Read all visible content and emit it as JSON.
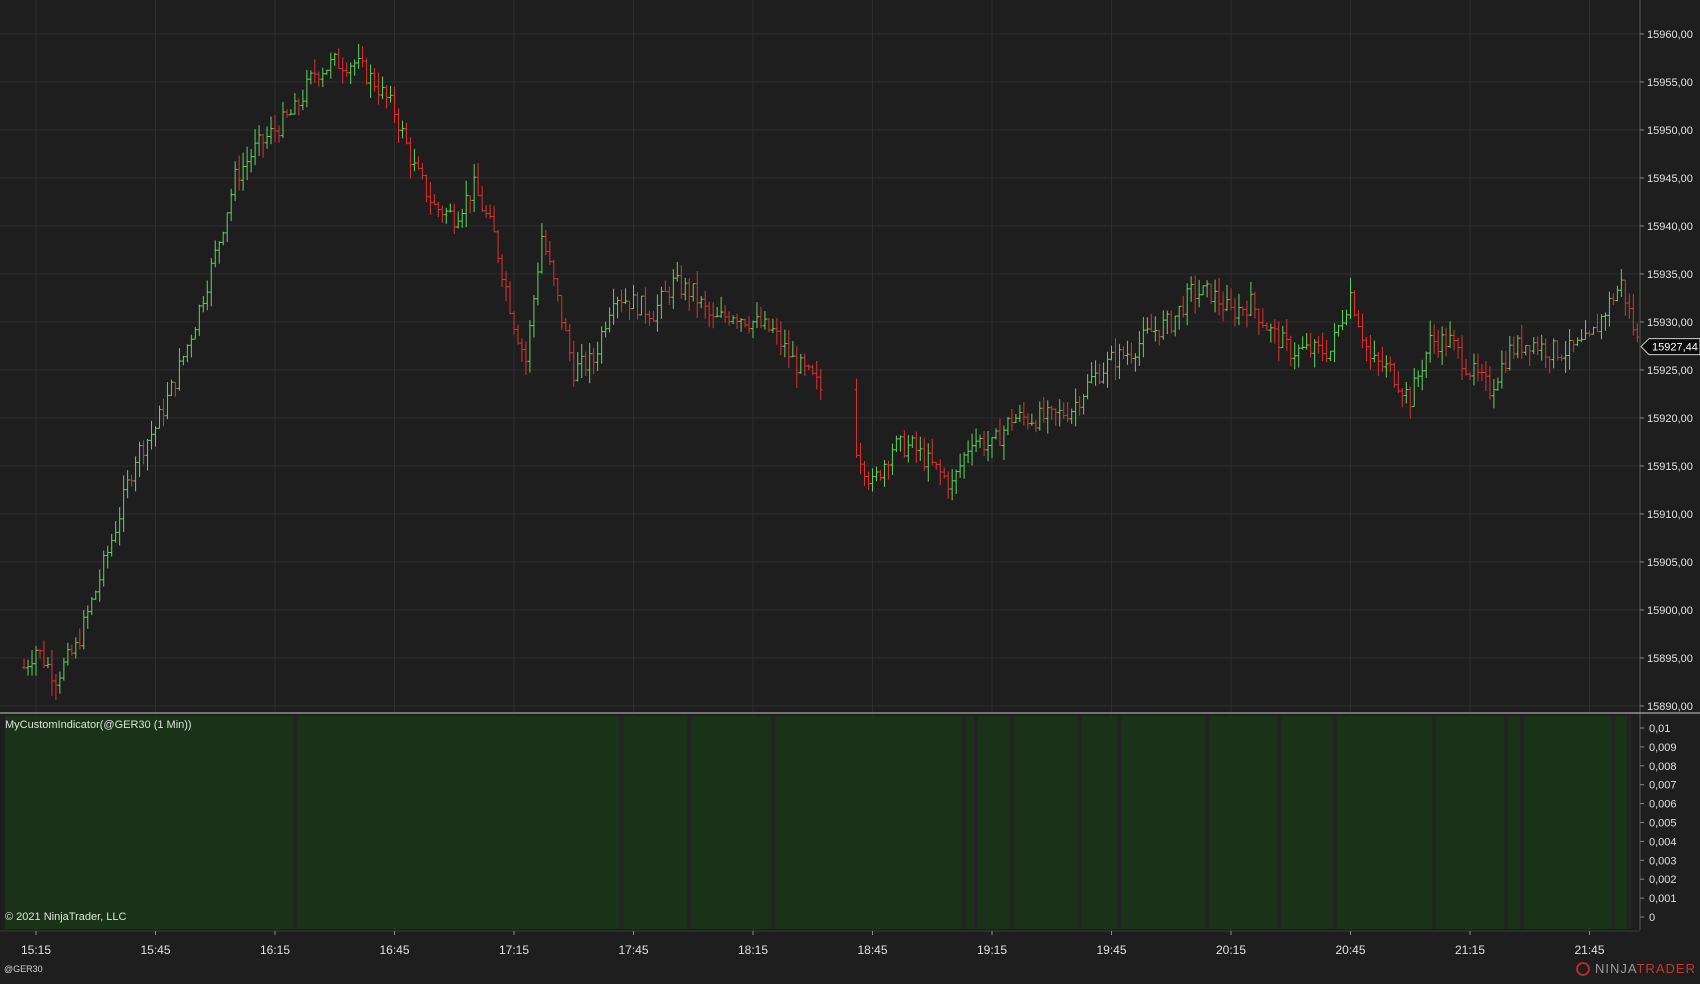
{
  "indicator_label": "MyCustomIndicator(@GER30 (1 Min))",
  "copyright": "© 2021 NinjaTrader, LLC",
  "instrument": "@GER30",
  "brand": {
    "primary": "NINJA",
    "accent": "TRADER",
    "mark": "ninjatrader-logo-icon"
  },
  "colors": {
    "background": "#1e1e1e",
    "up": "#5fd35f",
    "down": "#e03131",
    "grid": "#2e2e2e",
    "indicator_fill": "#1a3318",
    "indicator_gap": "#242424",
    "price_marker_bg": "#0b0b0b"
  },
  "chart_data": [
    {
      "type": "ohlc",
      "title": "",
      "x_ticks": [
        "15:15",
        "15:45",
        "16:15",
        "16:45",
        "17:15",
        "17:45",
        "18:15",
        "18:45",
        "19:15",
        "19:45",
        "20:15",
        "20:45",
        "21:15",
        "21:45"
      ],
      "y_ticks": [
        "15890,00",
        "15895,00",
        "15900,00",
        "15905,00",
        "15910,00",
        "15915,00",
        "15920,00",
        "15925,00",
        "15930,00",
        "15935,00",
        "15940,00",
        "15945,00",
        "15950,00",
        "15955,00",
        "15960,00"
      ],
      "ylim": [
        15889.5,
        15962
      ],
      "last_price": "15927,44",
      "last_price_value": 15927.44,
      "grid": true,
      "price_path": [
        [
          "15:12",
          15894
        ],
        [
          "15:15",
          15896
        ],
        [
          "15:20",
          15893
        ],
        [
          "15:25",
          15896
        ],
        [
          "15:30",
          15902
        ],
        [
          "15:36",
          15910
        ],
        [
          "15:40",
          15916
        ],
        [
          "15:45",
          15919
        ],
        [
          "15:50",
          15924
        ],
        [
          "15:55",
          15930
        ],
        [
          "16:00",
          15937
        ],
        [
          "16:05",
          15945
        ],
        [
          "16:10",
          15948
        ],
        [
          "16:15",
          15950
        ],
        [
          "16:20",
          15952
        ],
        [
          "16:25",
          15956
        ],
        [
          "16:30",
          15957
        ],
        [
          "16:35",
          15957
        ],
        [
          "16:40",
          15955
        ],
        [
          "16:45",
          15952
        ],
        [
          "16:50",
          15946
        ],
        [
          "16:55",
          15942
        ],
        [
          "17:00",
          15941
        ],
        [
          "17:05",
          15944
        ],
        [
          "17:10",
          15939
        ],
        [
          "17:15",
          15930
        ],
        [
          "17:18",
          15926
        ],
        [
          "17:22",
          15939
        ],
        [
          "17:25",
          15934
        ],
        [
          "17:30",
          15925
        ],
        [
          "17:35",
          15926
        ],
        [
          "17:40",
          15933
        ],
        [
          "17:45",
          15932
        ],
        [
          "17:50",
          15931
        ],
        [
          "17:55",
          15934
        ],
        [
          "18:00",
          15933
        ],
        [
          "18:05",
          15930
        ],
        [
          "18:10",
          15931
        ],
        [
          "18:15",
          15930
        ],
        [
          "18:20",
          15929
        ],
        [
          "18:25",
          15926
        ],
        [
          "18:30",
          15924
        ],
        [
          "18:32",
          15923
        ],
        [
          "18:41",
          15917
        ],
        [
          "18:45",
          15913
        ],
        [
          "18:50",
          15917
        ],
        [
          "18:55",
          15917
        ],
        [
          "19:00",
          15915
        ],
        [
          "19:05",
          15913
        ],
        [
          "19:10",
          15918
        ],
        [
          "19:15",
          15917
        ],
        [
          "19:20",
          15920
        ],
        [
          "19:25",
          15920
        ],
        [
          "19:30",
          15920
        ],
        [
          "19:35",
          15921
        ],
        [
          "19:40",
          15924
        ],
        [
          "19:45",
          15926
        ],
        [
          "19:50",
          15927
        ],
        [
          "19:55",
          15929
        ],
        [
          "20:00",
          15930
        ],
        [
          "20:05",
          15933
        ],
        [
          "20:10",
          15933
        ],
        [
          "20:15",
          15931
        ],
        [
          "20:20",
          15932
        ],
        [
          "20:25",
          15929
        ],
        [
          "20:30",
          15927
        ],
        [
          "20:35",
          15927
        ],
        [
          "20:40",
          15927
        ],
        [
          "20:45",
          15933
        ],
        [
          "20:50",
          15926
        ],
        [
          "20:55",
          15925
        ],
        [
          "21:00",
          15922
        ],
        [
          "21:05",
          15928
        ],
        [
          "21:10",
          15928
        ],
        [
          "21:15",
          15925
        ],
        [
          "21:20",
          15923
        ],
        [
          "21:25",
          15927
        ],
        [
          "21:30",
          15928
        ],
        [
          "21:35",
          15927
        ],
        [
          "21:40",
          15927
        ],
        [
          "21:45",
          15928
        ],
        [
          "21:50",
          15932
        ],
        [
          "21:53",
          15934
        ],
        [
          "21:57",
          15928
        ]
      ]
    },
    {
      "type": "bar",
      "title": "MyCustomIndicator(@GER30 (1 Min))",
      "y_ticks": [
        "0,01",
        "0,009",
        "0,008",
        "0,007",
        "0,006",
        "0,005",
        "0,004",
        "0,003",
        "0,002",
        "0,001",
        "0"
      ],
      "ylim": [
        0,
        0.01
      ],
      "value": 0.01,
      "gap_times": [
        "16:20",
        "17:42",
        "17:59",
        "18:20",
        "19:08",
        "19:11",
        "19:20",
        "19:37",
        "19:47",
        "20:09",
        "20:27",
        "20:41",
        "21:06",
        "21:24",
        "21:28",
        "21:51",
        "21:55"
      ]
    }
  ]
}
